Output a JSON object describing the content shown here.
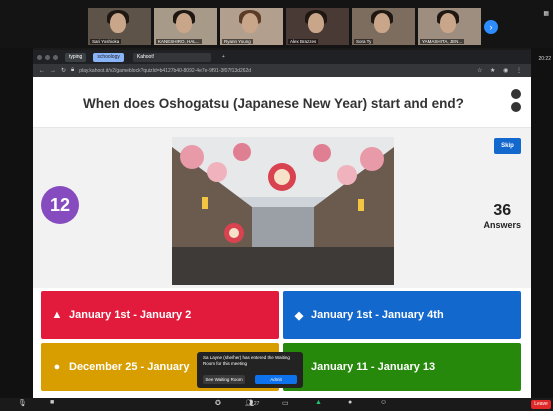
{
  "participants": [
    {
      "name": "Sari Yoshioka"
    },
    {
      "name": "KANESHIRO, HAL..."
    },
    {
      "name": "Ryann Young"
    },
    {
      "name": "Alex Brazzes"
    },
    {
      "name": "Sora Ty"
    },
    {
      "name": "YAMASHITA, JEN..."
    }
  ],
  "zoom": {
    "next_icon": "›",
    "time": "20:22",
    "leave_label": "Leave",
    "participants_count": "27"
  },
  "browser": {
    "tabs": [
      {
        "label": "typing"
      },
      {
        "label": "schoology"
      },
      {
        "label": "Kahoot!"
      }
    ],
    "new_tab": "+",
    "url": "play.kahoot.it/v2/gameblock?quizId=b4127b40-8092-4e7e-9f91-3f07f13d262d"
  },
  "kahoot": {
    "question": "When does Oshogatsu (Japanese New Year) start and end?",
    "timer": "12",
    "answers_count": "36",
    "answers_label": "Answers",
    "skip_label": "Skip",
    "answers": [
      {
        "symbol": "▲",
        "text": "January 1st - January 2",
        "color": "#e21b3c"
      },
      {
        "symbol": "◆",
        "text": "January 1st - January 4th",
        "color": "#1368ce"
      },
      {
        "symbol": "●",
        "text": "December 25 - January",
        "color": "#d89e00"
      },
      {
        "symbol": "■",
        "text": "January 11 - January 13",
        "color": "#26890c"
      }
    ]
  },
  "waiting_room": {
    "message": "Sa Layne (she/her) has entered the Waiting Room for this meeting",
    "see_label": "See Waiting Room",
    "admit_label": "Admit"
  }
}
